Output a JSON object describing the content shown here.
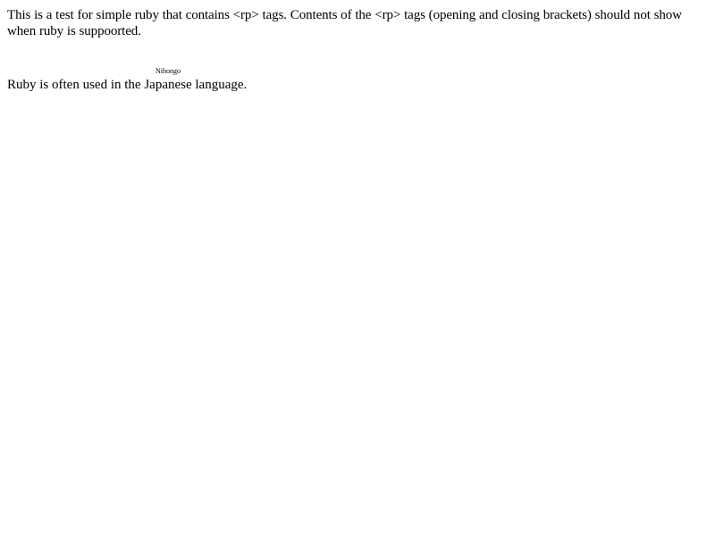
{
  "intro": {
    "text": "This is a test for simple ruby that contains <rp> tags. Contents of the <rp> tags (opening and closing brackets) should not show when ruby is suppoorted."
  },
  "ruby_line": {
    "before": "Ruby is often used in the ",
    "base": "Japanese",
    "annotation": "Nihongo",
    "after": " language."
  }
}
